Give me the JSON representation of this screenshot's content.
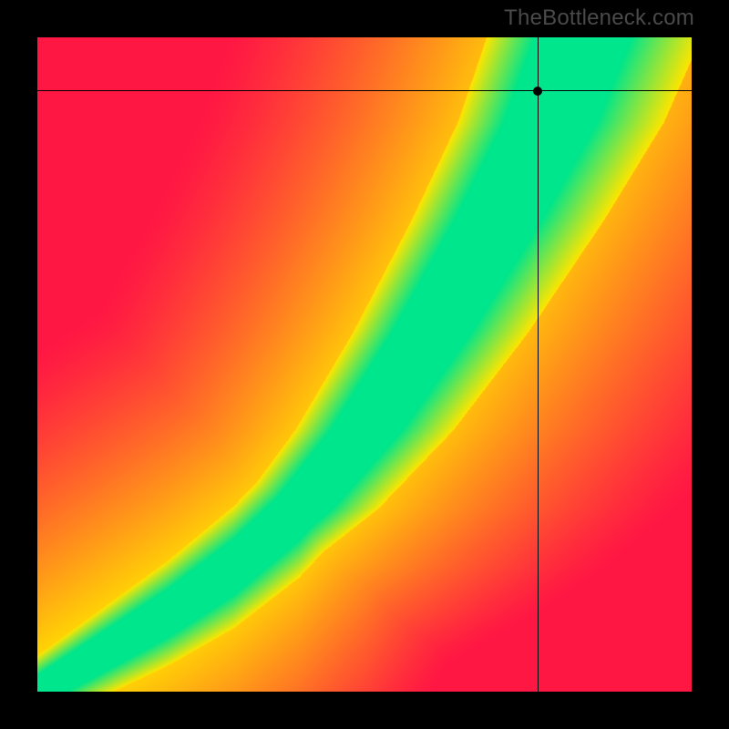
{
  "watermark": "TheBottleneck.com",
  "chart_data": {
    "type": "heatmap",
    "title": "",
    "xlabel": "",
    "ylabel": "",
    "xlim": [
      0,
      1
    ],
    "ylim": [
      0,
      1
    ],
    "color_scale": {
      "min_color": "#ff1744",
      "mid_color": "#ffe500",
      "max_color": "#00e68c",
      "description": "distance-from-ideal-curve gradient (red=far, yellow=medium, green=on-curve)"
    },
    "ideal_curve": {
      "description": "green ridge y = f(x) that represents the balanced (no bottleneck) line",
      "control_points": [
        {
          "x": 0.0,
          "y": 0.0
        },
        {
          "x": 0.1,
          "y": 0.06
        },
        {
          "x": 0.2,
          "y": 0.12
        },
        {
          "x": 0.3,
          "y": 0.19
        },
        {
          "x": 0.4,
          "y": 0.28
        },
        {
          "x": 0.5,
          "y": 0.4
        },
        {
          "x": 0.6,
          "y": 0.55
        },
        {
          "x": 0.7,
          "y": 0.72
        },
        {
          "x": 0.78,
          "y": 0.87
        },
        {
          "x": 0.83,
          "y": 1.0
        }
      ]
    },
    "crosshair": {
      "x": 0.765,
      "y": 0.918
    },
    "marker": {
      "x": 0.765,
      "y": 0.918
    },
    "grid": false,
    "legend": null
  },
  "colors": {
    "frame": "#000000",
    "watermark": "#4a4a4a"
  }
}
